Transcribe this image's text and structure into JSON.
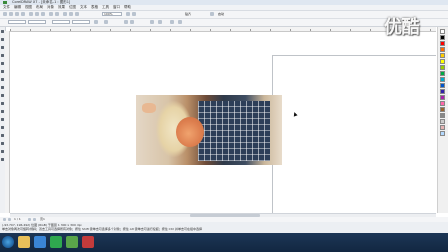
{
  "window": {
    "title": "CorelDRAW X7 - [未命名-1 : 图形1]"
  },
  "menu": [
    {
      "label": "文件"
    },
    {
      "label": "编辑"
    },
    {
      "label": "视图"
    },
    {
      "label": "布局"
    },
    {
      "label": "对象"
    },
    {
      "label": "效果"
    },
    {
      "label": "位图"
    },
    {
      "label": "文本"
    },
    {
      "label": "表格"
    },
    {
      "label": "工具"
    },
    {
      "label": "窗口"
    },
    {
      "label": "帮助"
    }
  ],
  "toolbar": {
    "zoom_value": "100%",
    "snap_label": "贴齐",
    "launch_label": "启动"
  },
  "property_bar": {
    "x": "",
    "y": "",
    "width": "",
    "height": ""
  },
  "pages": {
    "indicator": "1 / 1",
    "page_tab": "页1"
  },
  "status": {
    "line1": "(-93.707, 196.492)   位图 (RGB) 于图层 1 300 x 300 dpi",
    "line2": "单击对象两次可旋转/倾斜；双击工具可选择所有对象；按住 Shift 键单击可选择多个对象；按住 Alt 键单击可进行挖掘；按住 Ctrl 并单击可在组中选择"
  },
  "taskbar": {
    "clock_time": "",
    "clock_date": ""
  },
  "watermark": {
    "text": "优酷"
  },
  "colors": {
    "palette": [
      "#ffffff",
      "#000000",
      "#ff0000",
      "#ff6a00",
      "#ffcc00",
      "#ffff00",
      "#99cc00",
      "#00aa44",
      "#00aacc",
      "#0055cc",
      "#3322aa",
      "#aa22aa",
      "#ff66aa",
      "#996633",
      "#888888",
      "#cccccc",
      "#e6b3b3",
      "#b3d9ff"
    ]
  }
}
